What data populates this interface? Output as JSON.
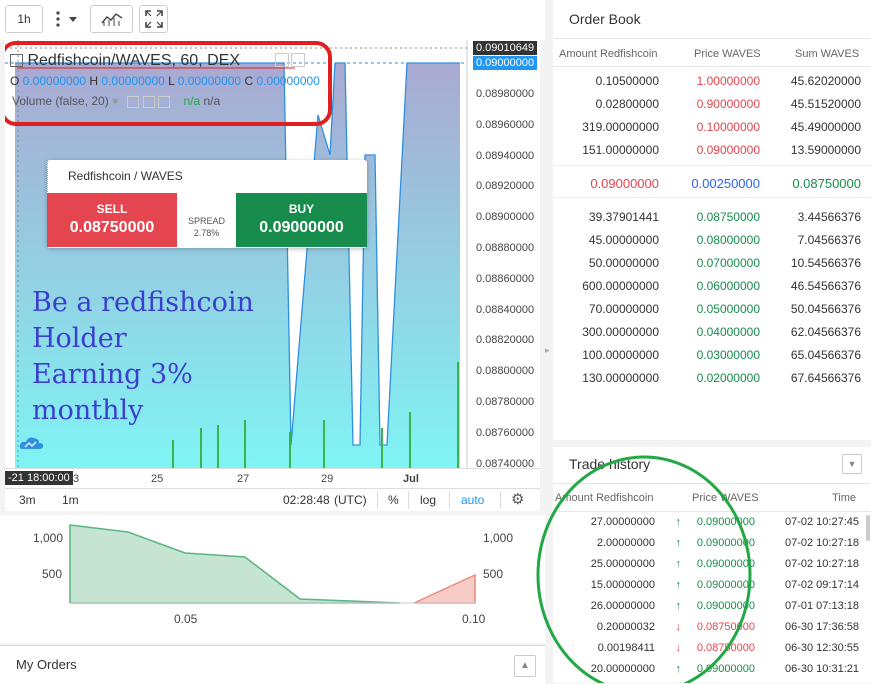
{
  "toolbar": {
    "interval": "1h"
  },
  "chart": {
    "legend_title": "Redfishcoin/WAVES, 60, DEX",
    "ohlc": [
      {
        "k": "O",
        "v": "0.00000000"
      },
      {
        "k": "H",
        "v": "0.00000000"
      },
      {
        "k": "L",
        "v": "0.00000000"
      },
      {
        "k": "C",
        "v": "0.00000000"
      }
    ],
    "volume_label": "Volume (false, 20)",
    "volume_values": [
      "n/a",
      "n/a"
    ],
    "price_axis": [
      "0.08980000",
      "0.08960000",
      "0.08940000",
      "0.08920000",
      "0.08900000",
      "0.08880000",
      "0.08860000",
      "0.08840000",
      "0.08820000",
      "0.08800000",
      "0.08780000",
      "0.08760000",
      "0.08740000"
    ],
    "price_tag_top": "0.09010649",
    "price_tag_current": "0.09000000",
    "x_axis": [
      "3",
      "25",
      "27",
      "29",
      "Jul"
    ],
    "x_axis_start": "-21 18:00:00",
    "footer": {
      "range_3m": "3m",
      "range_1m": "1m",
      "time": "02:28:48",
      "tz": "(UTC)",
      "pct": "%",
      "log": "log",
      "auto": "auto"
    },
    "promo_lines": [
      "Be a redfishcoin",
      "Holder",
      "Earning 3%",
      "monthly"
    ],
    "colors": {
      "line": "#2f8fe0",
      "area_top": "#a9a9d2",
      "area_bottom": "#7ff4f4",
      "promo": "#3b3fcf",
      "annotation_red": "#e02020",
      "annotation_green": "#22a845"
    }
  },
  "widget": {
    "pair": "Redfishcoin / WAVES",
    "sell_label": "SELL",
    "sell_price": "0.08750000",
    "spread_label": "SPREAD",
    "spread_value": "2.78%",
    "buy_label": "BUY",
    "buy_price": "0.09000000"
  },
  "depth": {
    "y_left": [
      "1,000",
      "500"
    ],
    "y_right": [
      "1,000",
      "500"
    ],
    "x": [
      "0.05",
      "0.10"
    ]
  },
  "my_orders": {
    "title": "My Orders"
  },
  "order_book": {
    "title": "Order Book",
    "headers": [
      "Amount Redfishcoin",
      "Price WAVES",
      "Sum WAVES"
    ],
    "asks": [
      {
        "amount": "0.10500000",
        "price": "1.00000000",
        "sum": "45.62020000"
      },
      {
        "amount": "0.02800000",
        "price": "0.90000000",
        "sum": "45.51520000"
      },
      {
        "amount": "319.00000000",
        "price": "0.10000000",
        "sum": "45.49000000"
      },
      {
        "amount": "151.00000000",
        "price": "0.09000000",
        "sum": "13.59000000"
      }
    ],
    "spread_row": {
      "ask": "0.09000000",
      "spread": "0.00250000",
      "bid": "0.08750000"
    },
    "bids": [
      {
        "amount": "39.37901441",
        "price": "0.08750000",
        "sum": "3.44566376"
      },
      {
        "amount": "45.00000000",
        "price": "0.08000000",
        "sum": "7.04566376"
      },
      {
        "amount": "50.00000000",
        "price": "0.07000000",
        "sum": "10.54566376"
      },
      {
        "amount": "600.00000000",
        "price": "0.06000000",
        "sum": "46.54566376"
      },
      {
        "amount": "70.00000000",
        "price": "0.05000000",
        "sum": "50.04566376"
      },
      {
        "amount": "300.00000000",
        "price": "0.04000000",
        "sum": "62.04566376"
      },
      {
        "amount": "100.00000000",
        "price": "0.03000000",
        "sum": "65.04566376"
      },
      {
        "amount": "130.00000000",
        "price": "0.02000000",
        "sum": "67.64566376"
      }
    ]
  },
  "trade_history": {
    "title": "Trade history",
    "headers": [
      "Amount Redfishcoin",
      "Price WAVES",
      "Time"
    ],
    "rows": [
      {
        "amount": "27.00000000",
        "dir": "up",
        "price": "0.09000000",
        "time": "07-02 10:27:45"
      },
      {
        "amount": "2.00000000",
        "dir": "up",
        "price": "0.09000000",
        "time": "07-02 10:27:18"
      },
      {
        "amount": "25.00000000",
        "dir": "up",
        "price": "0.09000000",
        "time": "07-02 10:27:18"
      },
      {
        "amount": "15.00000000",
        "dir": "up",
        "price": "0.09000000",
        "time": "07-02 09:17:14"
      },
      {
        "amount": "26.00000000",
        "dir": "up",
        "price": "0.09000000",
        "time": "07-01 07:13:18"
      },
      {
        "amount": "0.20000032",
        "dir": "down",
        "price": "0.08750000",
        "time": "06-30 17:36:58"
      },
      {
        "amount": "0.00198411",
        "dir": "down",
        "price": "0.08750000",
        "time": "06-30 12:30:55"
      },
      {
        "amount": "20.00000000",
        "dir": "up",
        "price": "0.09000000",
        "time": "06-30 10:31:21"
      }
    ]
  }
}
